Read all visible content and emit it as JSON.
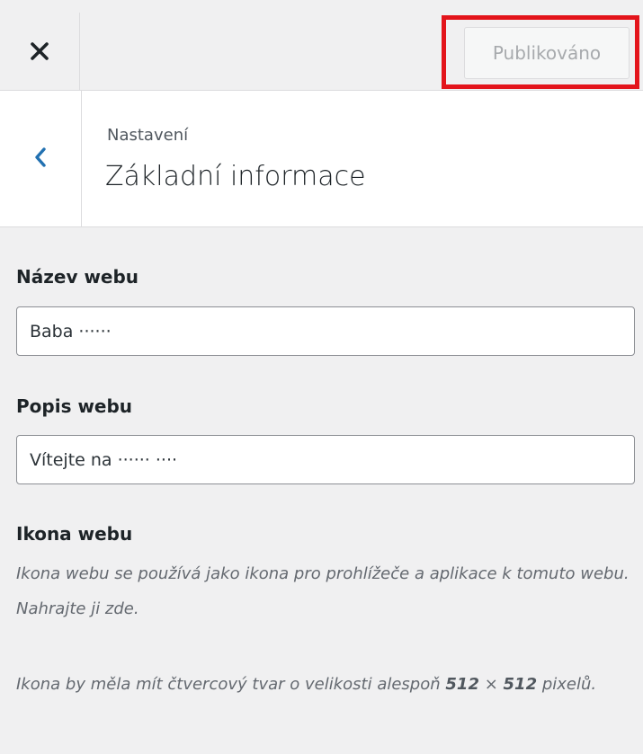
{
  "header": {
    "close_icon": "close-icon",
    "publish_label": "Publikováno",
    "highlight_color": "#e3141b"
  },
  "section": {
    "back_icon": "chevron-left-icon",
    "breadcrumb": "Nastavení",
    "title": "Základní informace"
  },
  "fields": {
    "site_title": {
      "label": "Název webu",
      "value": "Baba ······"
    },
    "tagline": {
      "label": "Popis webu",
      "value": "Vítejte na ······ ····"
    }
  },
  "site_icon": {
    "label": "Ikona webu",
    "description": "Ikona webu se používá jako ikona pro prohlížeče a aplikace k tomuto webu. Nahrajte ji zde.",
    "size_note_prefix": "Ikona by měla mít čtvercový tvar o velikosti alespoň",
    "size_a": "512",
    "size_sep": "×",
    "size_b": "512",
    "size_unit": "pixelů."
  },
  "colors": {
    "accent": "#2271b1",
    "background": "#f0f0f1"
  }
}
